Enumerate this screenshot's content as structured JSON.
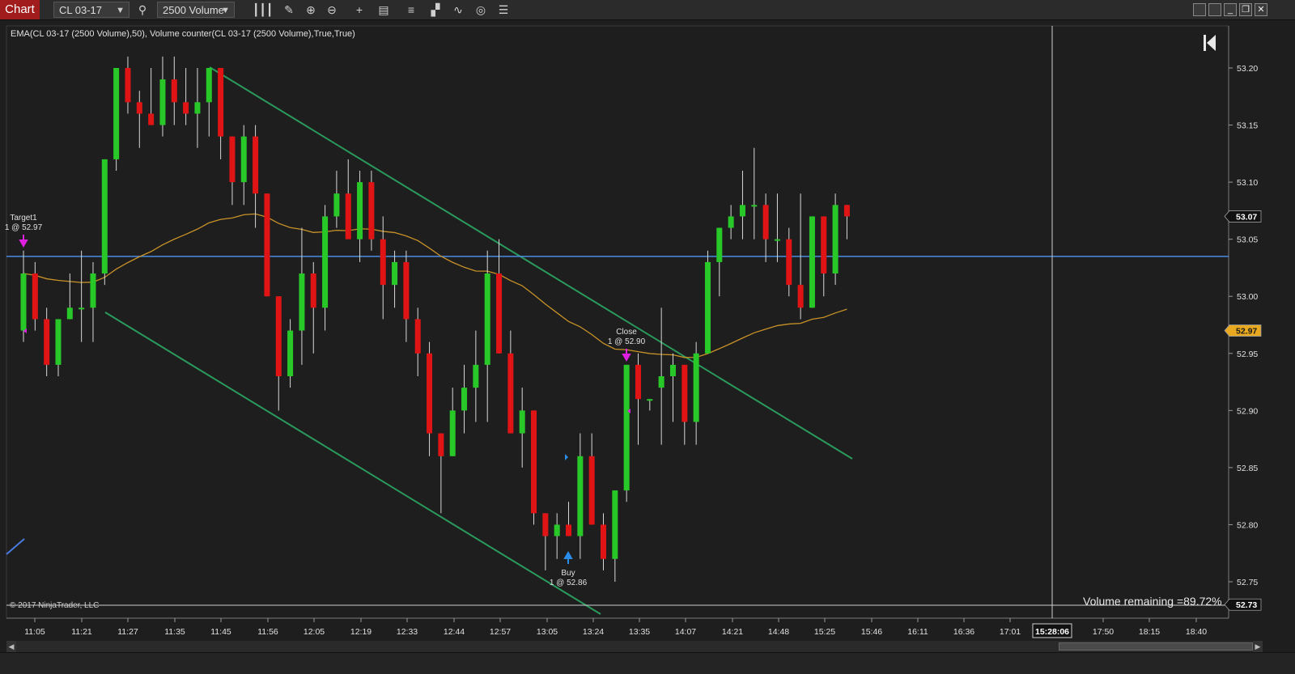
{
  "toolbar": {
    "chart_tab": "Chart",
    "instrument": "CL 03-17",
    "period": "2500 Volume"
  },
  "indicator_label": "EMA(CL 03-17 (2500 Volume),50), Volume counter(CL 03-17 (2500 Volume),True,True)",
  "copyright": "© 2017 NinjaTrader, LLC",
  "volume_remaining": "Volume remaining =89.72%",
  "colors": {
    "up": "#28c828",
    "down": "#e01414",
    "ema": "#c89228",
    "trend": "#2a9a5c",
    "hline": "#4a8be0",
    "marker_exit": "#e020e0",
    "marker_entry": "#2a8ce8",
    "price_label": "#e8a820"
  },
  "axis": {
    "y_ticks": [
      "53.20",
      "53.15",
      "53.10",
      "53.05",
      "53.00",
      "52.95",
      "52.90",
      "52.85",
      "52.80",
      "52.75"
    ],
    "x_ticks": [
      "11:05",
      "11:21",
      "11:27",
      "11:35",
      "11:45",
      "11:56",
      "12:05",
      "12:19",
      "12:33",
      "12:44",
      "12:57",
      "13:05",
      "13:24",
      "13:35",
      "14:07",
      "14:21",
      "14:48",
      "15:25",
      "15:46",
      "16:11",
      "16:36",
      "17:01",
      "17:50",
      "18:15",
      "18:40"
    ],
    "cursor_time": "15:28:06",
    "last_price": "53.07",
    "ema_price": "52.97",
    "cursor_price": "52.73"
  },
  "markers": {
    "target": {
      "title": "Target1",
      "detail": "1 @ 52.97"
    },
    "close": {
      "title": "Close",
      "detail": "1 @ 52.90"
    },
    "buy": {
      "title": "Buy",
      "detail": "1 @ 52.86"
    }
  },
  "chart_data": {
    "type": "candlestick",
    "ylim": [
      52.73,
      53.225
    ],
    "hline": 53.035,
    "candles": [
      {
        "o": 52.97,
        "h": 53.04,
        "l": 52.96,
        "c": 53.02
      },
      {
        "o": 53.02,
        "h": 53.03,
        "l": 52.97,
        "c": 52.98
      },
      {
        "o": 52.98,
        "h": 52.99,
        "l": 52.93,
        "c": 52.94
      },
      {
        "o": 52.94,
        "h": 52.98,
        "l": 52.93,
        "c": 52.98
      },
      {
        "o": 52.98,
        "h": 53.02,
        "l": 52.98,
        "c": 52.99
      },
      {
        "o": 52.99,
        "h": 53.04,
        "l": 52.96,
        "c": 52.99
      },
      {
        "o": 52.99,
        "h": 53.03,
        "l": 52.96,
        "c": 53.02
      },
      {
        "o": 53.02,
        "h": 53.05,
        "l": 53.01,
        "c": 53.12
      },
      {
        "o": 53.12,
        "h": 53.2,
        "l": 53.11,
        "c": 53.2
      },
      {
        "o": 53.2,
        "h": 53.21,
        "l": 53.16,
        "c": 53.17
      },
      {
        "o": 53.17,
        "h": 53.18,
        "l": 53.13,
        "c": 53.16
      },
      {
        "o": 53.16,
        "h": 53.2,
        "l": 53.15,
        "c": 53.15
      },
      {
        "o": 53.15,
        "h": 53.21,
        "l": 53.14,
        "c": 53.19
      },
      {
        "o": 53.19,
        "h": 53.21,
        "l": 53.15,
        "c": 53.17
      },
      {
        "o": 53.17,
        "h": 53.2,
        "l": 53.15,
        "c": 53.16
      },
      {
        "o": 53.16,
        "h": 53.2,
        "l": 53.13,
        "c": 53.17
      },
      {
        "o": 53.17,
        "h": 53.2,
        "l": 53.14,
        "c": 53.2
      },
      {
        "o": 53.2,
        "h": 53.2,
        "l": 53.12,
        "c": 53.14
      },
      {
        "o": 53.14,
        "h": 53.14,
        "l": 53.08,
        "c": 53.1
      },
      {
        "o": 53.1,
        "h": 53.15,
        "l": 53.08,
        "c": 53.14
      },
      {
        "o": 53.14,
        "h": 53.15,
        "l": 53.06,
        "c": 53.09
      },
      {
        "o": 53.09,
        "h": 53.09,
        "l": 53.0,
        "c": 53.0
      },
      {
        "o": 53.0,
        "h": 53.0,
        "l": 52.9,
        "c": 52.93
      },
      {
        "o": 52.93,
        "h": 52.98,
        "l": 52.92,
        "c": 52.97
      },
      {
        "o": 52.97,
        "h": 53.06,
        "l": 52.94,
        "c": 53.02
      },
      {
        "o": 53.02,
        "h": 53.03,
        "l": 52.95,
        "c": 52.99
      },
      {
        "o": 52.99,
        "h": 53.08,
        "l": 52.97,
        "c": 53.07
      },
      {
        "o": 53.07,
        "h": 53.11,
        "l": 53.06,
        "c": 53.09
      },
      {
        "o": 53.09,
        "h": 53.12,
        "l": 53.06,
        "c": 53.05
      },
      {
        "o": 53.05,
        "h": 53.11,
        "l": 53.03,
        "c": 53.1
      },
      {
        "o": 53.1,
        "h": 53.11,
        "l": 53.04,
        "c": 53.05
      },
      {
        "o": 53.05,
        "h": 53.07,
        "l": 52.98,
        "c": 53.01
      },
      {
        "o": 53.01,
        "h": 53.04,
        "l": 52.99,
        "c": 53.03
      },
      {
        "o": 53.03,
        "h": 53.04,
        "l": 52.96,
        "c": 52.98
      },
      {
        "o": 52.98,
        "h": 52.99,
        "l": 52.93,
        "c": 52.95
      },
      {
        "o": 52.95,
        "h": 52.96,
        "l": 52.86,
        "c": 52.88
      },
      {
        "o": 52.88,
        "h": 52.88,
        "l": 52.81,
        "c": 52.86
      },
      {
        "o": 52.86,
        "h": 52.92,
        "l": 52.86,
        "c": 52.9
      },
      {
        "o": 52.9,
        "h": 52.94,
        "l": 52.88,
        "c": 52.92
      },
      {
        "o": 52.92,
        "h": 52.97,
        "l": 52.89,
        "c": 52.94
      },
      {
        "o": 52.94,
        "h": 53.04,
        "l": 52.89,
        "c": 53.02
      },
      {
        "o": 53.02,
        "h": 53.05,
        "l": 52.95,
        "c": 52.95
      },
      {
        "o": 52.95,
        "h": 52.97,
        "l": 52.88,
        "c": 52.88
      },
      {
        "o": 52.88,
        "h": 52.92,
        "l": 52.85,
        "c": 52.9
      },
      {
        "o": 52.9,
        "h": 52.9,
        "l": 52.8,
        "c": 52.81
      },
      {
        "o": 52.81,
        "h": 52.81,
        "l": 52.76,
        "c": 52.79
      },
      {
        "o": 52.79,
        "h": 52.81,
        "l": 52.77,
        "c": 52.8
      },
      {
        "o": 52.8,
        "h": 52.82,
        "l": 52.79,
        "c": 52.79
      },
      {
        "o": 52.79,
        "h": 52.88,
        "l": 52.77,
        "c": 52.86
      },
      {
        "o": 52.86,
        "h": 52.88,
        "l": 52.8,
        "c": 52.8
      },
      {
        "o": 52.8,
        "h": 52.81,
        "l": 52.76,
        "c": 52.77
      },
      {
        "o": 52.77,
        "h": 52.83,
        "l": 52.75,
        "c": 52.83
      },
      {
        "o": 52.83,
        "h": 52.94,
        "l": 52.82,
        "c": 52.94
      },
      {
        "o": 52.94,
        "h": 52.95,
        "l": 52.87,
        "c": 52.91
      },
      {
        "o": 52.91,
        "h": 52.91,
        "l": 52.9,
        "c": 52.91
      },
      {
        "o": 52.92,
        "h": 52.99,
        "l": 52.87,
        "c": 52.93
      },
      {
        "o": 52.93,
        "h": 52.95,
        "l": 52.89,
        "c": 52.94
      },
      {
        "o": 52.94,
        "h": 52.94,
        "l": 52.87,
        "c": 52.89
      },
      {
        "o": 52.89,
        "h": 52.96,
        "l": 52.87,
        "c": 52.95
      },
      {
        "o": 52.95,
        "h": 53.04,
        "l": 52.95,
        "c": 53.03
      },
      {
        "o": 53.03,
        "h": 53.06,
        "l": 53.0,
        "c": 53.06
      },
      {
        "o": 53.06,
        "h": 53.08,
        "l": 53.05,
        "c": 53.07
      },
      {
        "o": 53.07,
        "h": 53.11,
        "l": 53.05,
        "c": 53.08
      },
      {
        "o": 53.08,
        "h": 53.13,
        "l": 53.05,
        "c": 53.08
      },
      {
        "o": 53.08,
        "h": 53.09,
        "l": 53.03,
        "c": 53.05
      },
      {
        "o": 53.05,
        "h": 53.09,
        "l": 53.03,
        "c": 53.05
      },
      {
        "o": 53.05,
        "h": 53.06,
        "l": 53.0,
        "c": 53.01
      },
      {
        "o": 53.01,
        "h": 53.09,
        "l": 52.98,
        "c": 52.99
      },
      {
        "o": 52.99,
        "h": 53.07,
        "l": 52.99,
        "c": 53.07
      },
      {
        "o": 53.07,
        "h": 53.07,
        "l": 53.0,
        "c": 53.02
      },
      {
        "o": 53.02,
        "h": 53.09,
        "l": 53.01,
        "c": 53.08
      },
      {
        "o": 53.08,
        "h": 53.08,
        "l": 53.05,
        "c": 53.07
      }
    ]
  }
}
